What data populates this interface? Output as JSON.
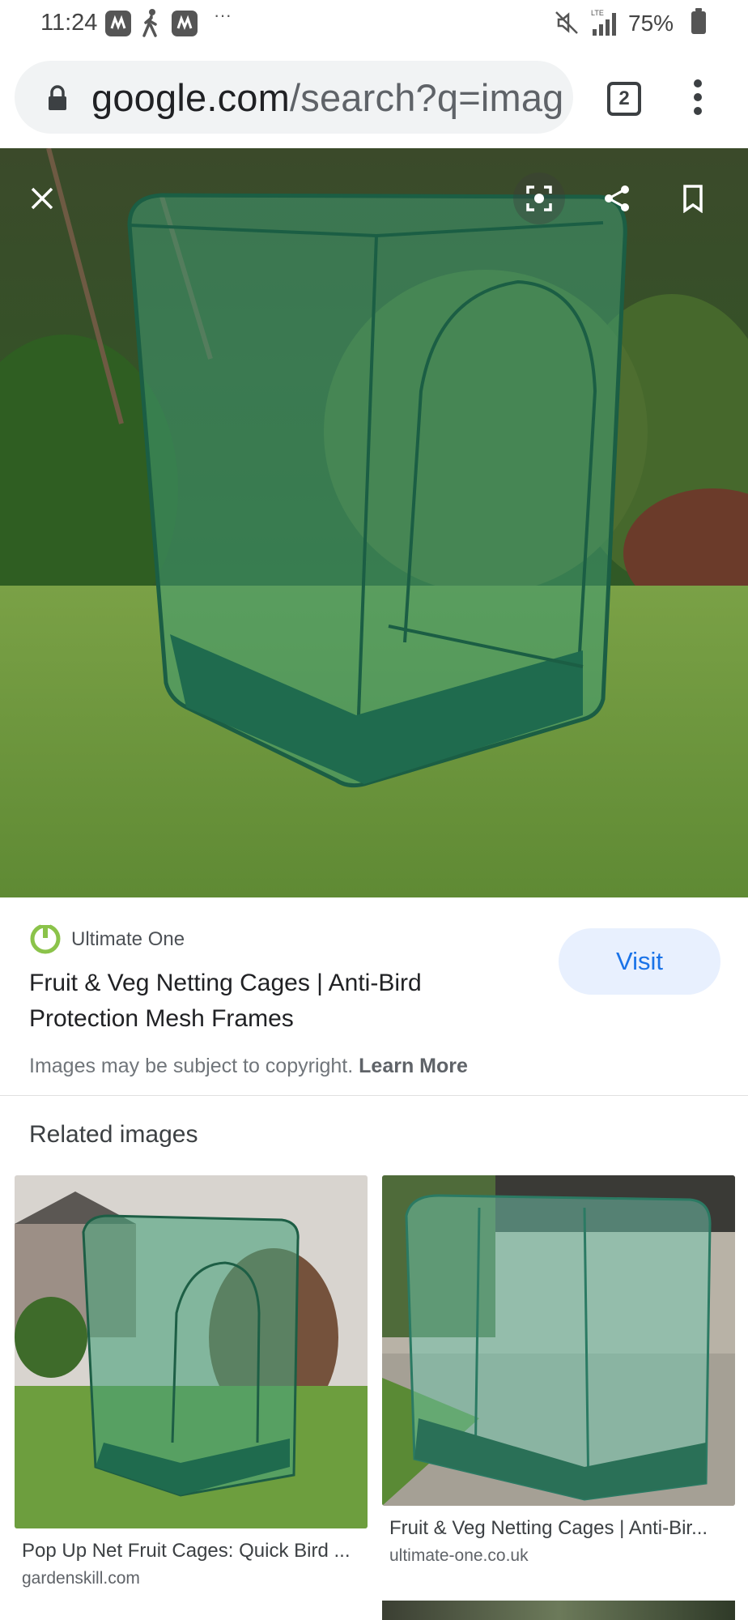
{
  "status_bar": {
    "time": "11:24",
    "battery": "75%",
    "icons": [
      "app-notification-icon",
      "walk-icon",
      "app-notification-icon",
      "more-dots-icon",
      "mute-icon",
      "lte-signal-icon",
      "battery-icon"
    ],
    "overflow": "···"
  },
  "browser": {
    "url_domain": "google.com",
    "url_path": "/search?q=imag",
    "tab_count": "2",
    "icons": [
      "lock-icon",
      "tabs-icon",
      "more-vert-icon"
    ]
  },
  "viewer": {
    "icons": [
      "close-icon",
      "lens-icon",
      "share-icon",
      "bookmark-icon"
    ],
    "image": "green pop-up netting cage on lawn"
  },
  "result": {
    "source_name": "Ultimate One",
    "title": "Fruit & Veg Netting Cages | Anti-Bird Protection Mesh Frames",
    "visit_label": "Visit",
    "copyright_text": "Images may be subject to copyright.",
    "learn_more": "Learn More",
    "accent_color": "#1a73e8",
    "logo_color": "#8bc34a"
  },
  "related": {
    "heading": "Related images",
    "items": [
      {
        "title": "Pop Up Net Fruit Cages: Quick Bird ...",
        "domain": "gardenskill.com"
      },
      {
        "title": "Fruit & Veg Netting Cages | Anti-Bir...",
        "domain": "ultimate-one.co.uk"
      }
    ]
  }
}
